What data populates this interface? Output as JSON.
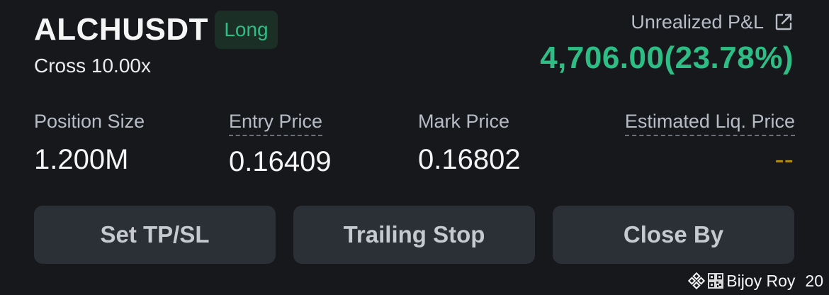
{
  "position": {
    "symbol": "ALCHUSDT",
    "side": "Long",
    "margin_mode": "Cross 10.00x"
  },
  "pnl": {
    "label": "Unrealized P&L",
    "value": "4,706.00(23.78%)",
    "share_icon": "share-external-icon"
  },
  "stats": {
    "position_size": {
      "label": "Position Size",
      "value": "1.200M"
    },
    "entry_price": {
      "label": "Entry Price",
      "value": "0.16409"
    },
    "mark_price": {
      "label": "Mark Price",
      "value": "0.16802"
    },
    "liq_price": {
      "label": "Estimated Liq. Price",
      "value": "--"
    }
  },
  "actions": {
    "set_tpsl": "Set TP/SL",
    "trailing_stop": "Trailing Stop",
    "close_by": "Close By"
  },
  "watermark": {
    "name": "Bijoy Roy",
    "year": "20",
    "logo_icon": "binance-logo-icon",
    "qr_icon": "qr-code-icon"
  },
  "colors": {
    "profit": "#2ebd85",
    "badge_bg": "#1c2f27",
    "liq_dash": "#f0b90b",
    "background": "#17181c",
    "button_bg": "#2b2f36"
  }
}
